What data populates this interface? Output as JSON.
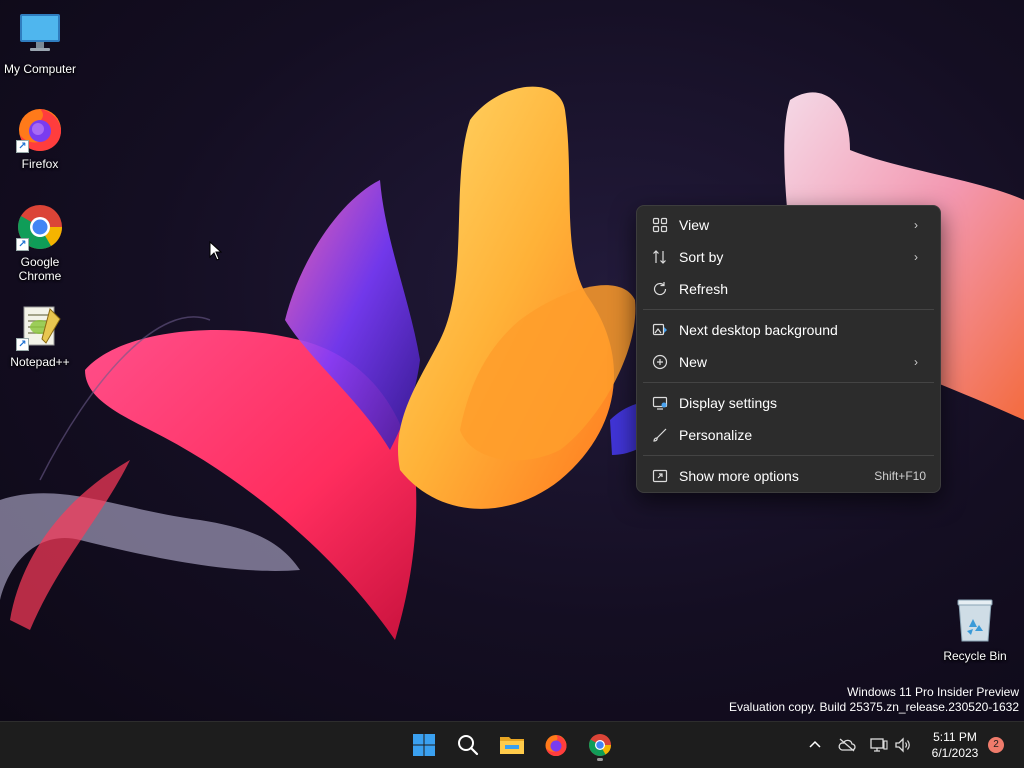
{
  "desktop": {
    "icons": [
      {
        "label": "My Computer",
        "icon": "monitor-icon"
      },
      {
        "label": "Firefox",
        "icon": "firefox-icon"
      },
      {
        "label": "Google Chrome",
        "icon": "chrome-icon"
      },
      {
        "label": "Notepad++",
        "icon": "notepadpp-icon"
      },
      {
        "label": "Recycle Bin",
        "icon": "recycle-bin-icon"
      }
    ]
  },
  "context_menu": {
    "items": [
      {
        "label": "View",
        "icon": "grid-view-icon",
        "submenu": true
      },
      {
        "label": "Sort by",
        "icon": "sort-icon",
        "submenu": true
      },
      {
        "label": "Refresh",
        "icon": "refresh-icon"
      },
      {
        "label": "Next desktop background",
        "icon": "next-background-icon"
      },
      {
        "label": "New",
        "icon": "plus-circle-icon",
        "submenu": true
      },
      {
        "label": "Display settings",
        "icon": "display-settings-icon"
      },
      {
        "label": "Personalize",
        "icon": "brush-icon"
      },
      {
        "label": "Show more options",
        "icon": "more-options-icon",
        "shortcut": "Shift+F10"
      }
    ],
    "arrow_glyph": "›"
  },
  "watermark": {
    "line1": "Windows 11 Pro Insider Preview",
    "line2": "Evaluation copy. Build 25375.zn_release.230520-1632"
  },
  "taskbar": {
    "apps": [
      "start-icon",
      "search-icon",
      "file-explorer-icon",
      "firefox-icon",
      "chrome-icon"
    ],
    "active_app": "chrome-icon",
    "tray": [
      "chevron-up-icon",
      "cloud-offline-icon",
      "network-icon",
      "volume-icon"
    ],
    "time": "5:11 PM",
    "date": "6/1/2023",
    "notification_count": "2"
  },
  "colors": {
    "menu_bg": "#2c2c2c",
    "taskbar_bg": "#1d1d1d",
    "start_blue": "#3aa0f0",
    "badge": "#ef7b6b"
  }
}
